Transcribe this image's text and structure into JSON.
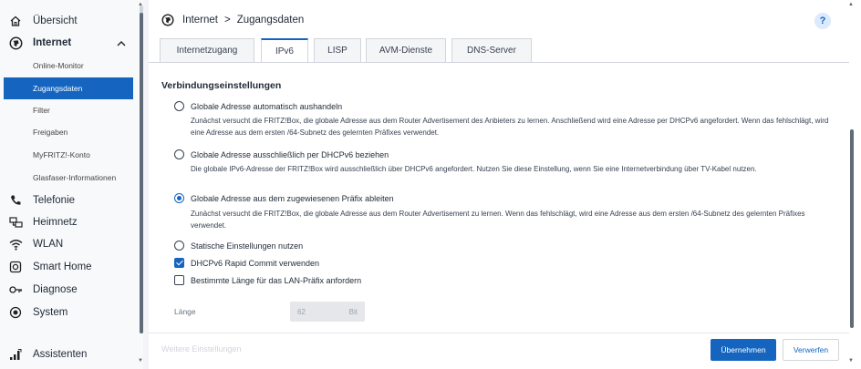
{
  "sidebar": {
    "items": [
      {
        "label": "Übersicht",
        "icon": "home-icon"
      },
      {
        "label": "Internet",
        "icon": "globe-icon",
        "expanded": true
      },
      {
        "label": "Telefonie",
        "icon": "phone-icon"
      },
      {
        "label": "Heimnetz",
        "icon": "network-icon"
      },
      {
        "label": "WLAN",
        "icon": "wifi-icon"
      },
      {
        "label": "Smart Home",
        "icon": "smart-home-icon"
      },
      {
        "label": "Diagnose",
        "icon": "diagnose-icon"
      },
      {
        "label": "System",
        "icon": "system-icon"
      }
    ],
    "subitems": [
      {
        "label": "Online-Monitor"
      },
      {
        "label": "Zugangsdaten",
        "active": true
      },
      {
        "label": "Filter"
      },
      {
        "label": "Freigaben"
      },
      {
        "label": "MyFRITZ!-Konto"
      },
      {
        "label": "Glasfaser-Informationen"
      }
    ],
    "assistant": {
      "label": "Assistenten",
      "icon": "assistant-icon"
    }
  },
  "breadcrumb": {
    "section": "Internet",
    "separator": ">",
    "page": "Zugangsdaten"
  },
  "help_label": "?",
  "tabs": [
    {
      "label": "Internetzugang"
    },
    {
      "label": "IPv6",
      "active": true
    },
    {
      "label": "LISP"
    },
    {
      "label": "AVM-Dienste"
    },
    {
      "label": "DNS-Server"
    }
  ],
  "section_title": "Verbindungseinstellungen",
  "options": [
    {
      "type": "radio",
      "checked": false,
      "label": "Globale Adresse automatisch aushandeln",
      "desc": "Zunächst versucht die FRITZ!Box, die globale Adresse aus dem Router Advertisement des Anbieters zu lernen. Anschließend wird eine Adresse per DHCPv6 angefordert. Wenn das fehlschlägt, wird eine Adresse aus dem ersten /64-Subnetz des gelernten Präfixes verwendet."
    },
    {
      "type": "radio",
      "checked": false,
      "label": "Globale Adresse ausschließlich per DHCPv6 beziehen",
      "desc": "Die globale IPv6-Adresse der FRITZ!Box wird ausschließlich über DHCPv6 angefordert. Nutzen Sie diese Einstellung, wenn Sie eine Internetverbindung über TV-Kabel nutzen."
    },
    {
      "type": "radio",
      "checked": true,
      "label": "Globale Adresse aus dem zugewiesenen Präfix ableiten",
      "desc": "Zunächst versucht die FRITZ!Box, die globale Adresse aus dem Router Advertisement zu lernen. Wenn das fehlschlägt, wird eine Adresse aus dem ersten /64-Subnetz des gelernten Präfixes verwendet."
    },
    {
      "type": "radio",
      "checked": false,
      "label": "Statische Einstellungen nutzen"
    },
    {
      "type": "checkbox",
      "checked": true,
      "label": "DHCPv6 Rapid Commit verwenden"
    },
    {
      "type": "checkbox",
      "checked": false,
      "label": "Bestimmte Länge für das LAN-Präfix anfordern"
    }
  ],
  "length_field": {
    "label": "Länge",
    "value": "62",
    "unit": "Bit"
  },
  "footer": {
    "faded_label": "Weitere Einstellungen",
    "apply_label": "Übernehmen",
    "discard_label": "Verwerfen"
  },
  "colors": {
    "accent": "#1565c0",
    "sidebar_bg": "#f8f9fa",
    "content_bg": "#ffffff"
  }
}
